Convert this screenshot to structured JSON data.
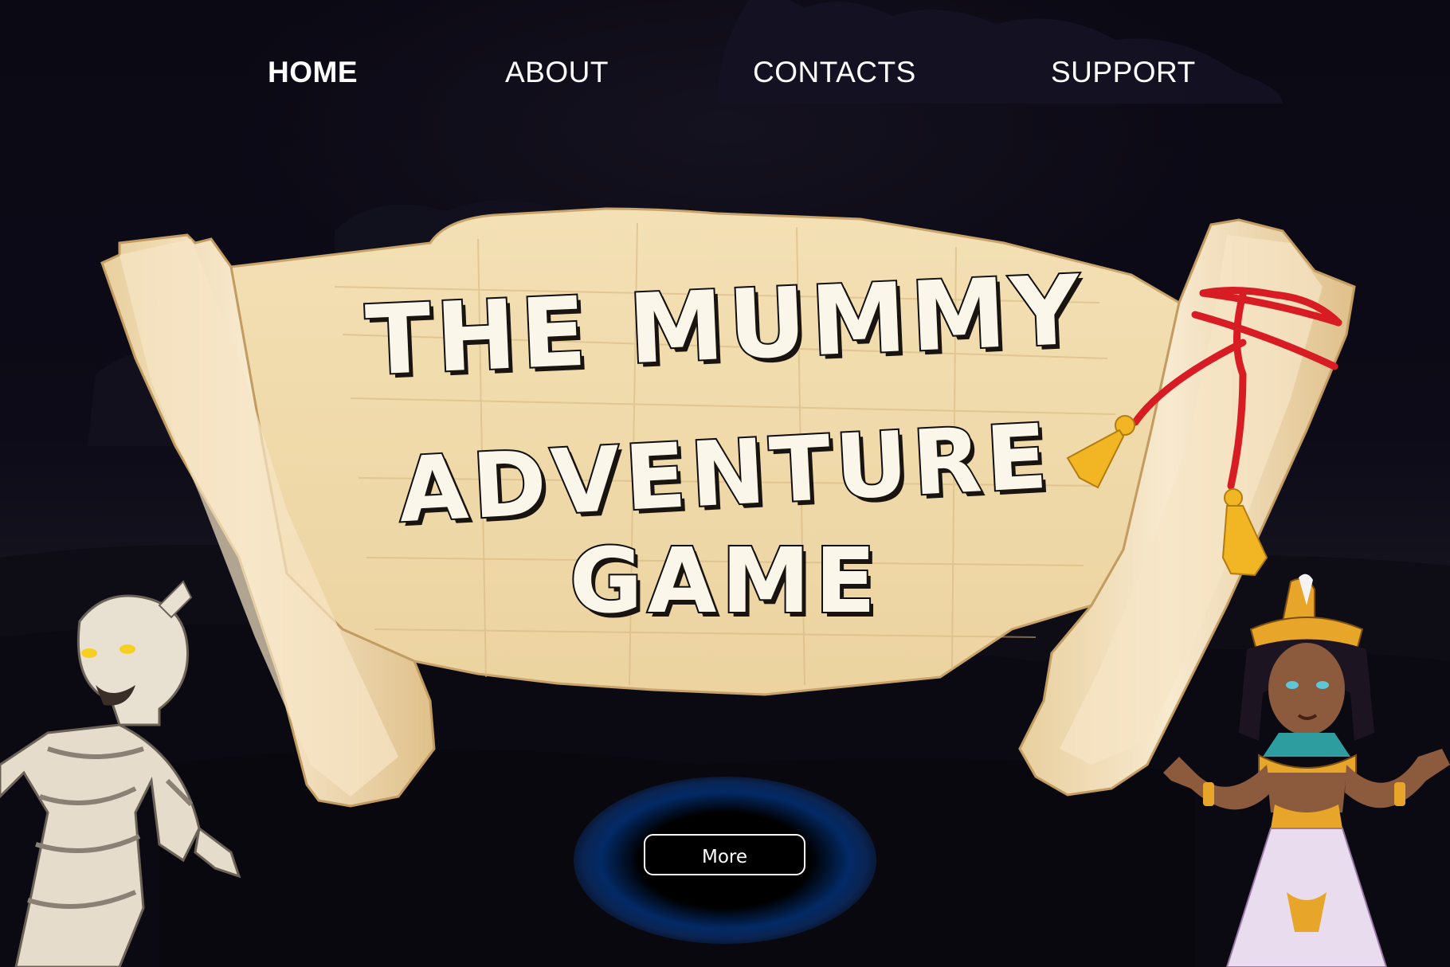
{
  "nav": {
    "items": [
      {
        "label": "HOME",
        "active": true
      },
      {
        "label": "ABOUT",
        "active": false
      },
      {
        "label": "CONTACTS",
        "active": false
      },
      {
        "label": "SUPPORT",
        "active": false
      }
    ]
  },
  "hero": {
    "title_line_1": "THE MUMMY",
    "title_line_2": "ADVENTURE",
    "title_line_3": "GAME",
    "more_label": "More"
  },
  "colors": {
    "background": "#0c0a16",
    "scroll_paper": "#f0dcb0",
    "title_fill": "#fbf6ea",
    "ribbon": "#d81c24",
    "tassel": "#f2b624",
    "button_glow": "#0a3c8c"
  },
  "characters": [
    "mummy",
    "egyptian-queen"
  ]
}
